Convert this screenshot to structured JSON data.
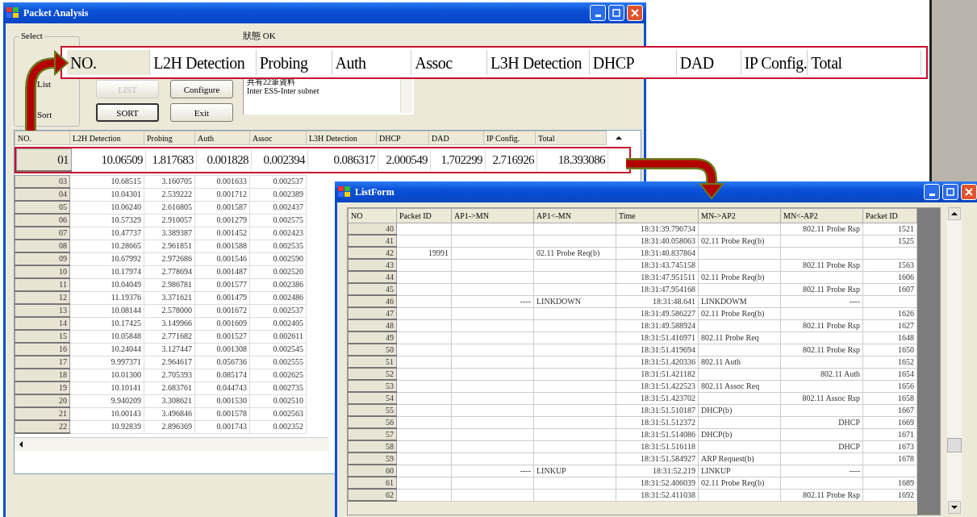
{
  "main_window": {
    "title": "Packet Analysis",
    "status": "狀態 OK",
    "select_group": {
      "label": "Select",
      "options": [
        "List",
        "Sort"
      ]
    },
    "buttons": [
      {
        "label": "LIST",
        "disabled": true
      },
      {
        "label": "Configure",
        "disabled": false
      },
      {
        "label": "SORT",
        "disabled": false
      },
      {
        "label": "Exit",
        "disabled": false
      }
    ],
    "info_lines": [
      "共有22筆資料",
      "Inter ESS-Inter subnet"
    ],
    "grid": {
      "columns": [
        "NO.",
        "L2H Detection",
        "Probing",
        "Auth",
        "Assoc",
        "L3H Detection",
        "DHCP",
        "DAD",
        "IP Config.",
        "Total"
      ],
      "rows": [
        {
          "no": "01",
          "highlighted": true,
          "values": [
            "10.06509",
            "1.817683",
            "0.001828",
            "0.002394",
            "0.086317",
            "2.000549",
            "1.702299",
            "2.716926",
            "18.393086"
          ]
        },
        {
          "no": "03",
          "highlighted": false,
          "values": [
            "10.68515",
            "3.160705",
            "0.001633",
            "0.002537"
          ]
        },
        {
          "no": "04",
          "highlighted": false,
          "values": [
            "10.04301",
            "2.539222",
            "0.001712",
            "0.002389"
          ]
        },
        {
          "no": "05",
          "highlighted": false,
          "values": [
            "10.06240",
            "2.616805",
            "0.001587",
            "0.002437"
          ]
        },
        {
          "no": "06",
          "highlighted": false,
          "values": [
            "10.57329",
            "2.910057",
            "0.001279",
            "0.002575"
          ]
        },
        {
          "no": "07",
          "highlighted": false,
          "values": [
            "10.47737",
            "3.389387",
            "0.001452",
            "0.002423"
          ]
        },
        {
          "no": "08",
          "highlighted": false,
          "values": [
            "10.28665",
            "2.961851",
            "0.001588",
            "0.002535"
          ]
        },
        {
          "no": "09",
          "highlighted": false,
          "values": [
            "10.67992",
            "2.972686",
            "0.001546",
            "0.002590"
          ]
        },
        {
          "no": "10",
          "highlighted": false,
          "values": [
            "10.17974",
            "2.778694",
            "0.001487",
            "0.002520"
          ]
        },
        {
          "no": "11",
          "highlighted": false,
          "values": [
            "10.04049",
            "2.986781",
            "0.001577",
            "0.002386"
          ]
        },
        {
          "no": "12",
          "highlighted": false,
          "values": [
            "11.19376",
            "3.371621",
            "0.001479",
            "0.002486"
          ]
        },
        {
          "no": "13",
          "highlighted": false,
          "values": [
            "10.08144",
            "2.578000",
            "0.001672",
            "0.002537"
          ]
        },
        {
          "no": "14",
          "highlighted": false,
          "values": [
            "10.17425",
            "3.149966",
            "0.001609",
            "0.002405"
          ]
        },
        {
          "no": "15",
          "highlighted": false,
          "values": [
            "10.05848",
            "2.771682",
            "0.001527",
            "0.002611"
          ]
        },
        {
          "no": "16",
          "highlighted": false,
          "values": [
            "10.24044",
            "3.127447",
            "0.001308",
            "0.002545"
          ]
        },
        {
          "no": "17",
          "highlighted": false,
          "values": [
            "9.997371",
            "2.964617",
            "0.056736",
            "0.002555"
          ]
        },
        {
          "no": "18",
          "highlighted": false,
          "values": [
            "10.01300",
            "2.705393",
            "0.085174",
            "0.002625"
          ]
        },
        {
          "no": "19",
          "highlighted": false,
          "values": [
            "10.10141",
            "2.683761",
            "0.044743",
            "0.002735"
          ]
        },
        {
          "no": "20",
          "highlighted": false,
          "values": [
            "9.940209",
            "3.308621",
            "0.001530",
            "0.002510"
          ]
        },
        {
          "no": "21",
          "highlighted": false,
          "values": [
            "10.00143",
            "3.496846",
            "0.001578",
            "0.002563"
          ]
        },
        {
          "no": "22",
          "highlighted": false,
          "values": [
            "10.92839",
            "2.896369",
            "0.001743",
            "0.002352"
          ]
        }
      ]
    }
  },
  "callout_header": {
    "columns": [
      "NO.",
      "L2H Detection",
      "Probing",
      "Auth",
      "Assoc",
      "L3H Detection",
      "DHCP",
      "DAD",
      "IP Config.",
      "Total"
    ]
  },
  "list_window": {
    "title": "ListForm",
    "columns": [
      "NO",
      "Packet ID",
      "AP1->MN",
      "AP1<-MN",
      "Time",
      "MN->AP2",
      "MN<-AP2",
      "Packet ID"
    ],
    "rows": [
      {
        "no": "40",
        "time": "18:31:39.796734",
        "mn_from_ap2": "802.11 Probe Rsp",
        "packet_id_2": "1521"
      },
      {
        "no": "41",
        "time": "18:31:40.058063",
        "mn_to_ap2": "02.11 Probe Req(b)",
        "packet_id_2": "1525"
      },
      {
        "no": "42",
        "packet_id_1": "19991",
        "ap1_from_mn": "02.11 Probe Req(b)",
        "time": "18:31:40.837864"
      },
      {
        "no": "43",
        "time": "18:31:43.745158",
        "mn_from_ap2": "802.11 Probe Rsp",
        "packet_id_2": "1563"
      },
      {
        "no": "44",
        "time": "18:31:47.951511",
        "mn_to_ap2": "02.11 Probe Req(b)",
        "packet_id_2": "1606"
      },
      {
        "no": "45",
        "time": "18:31:47.954168",
        "mn_from_ap2": "802.11 Probe Rsp",
        "packet_id_2": "1607"
      },
      {
        "no": "46",
        "ap1_to_mn": "----",
        "ap1_from_mn": "LINKDOWN",
        "time": "18:31:48.641",
        "mn_to_ap2": "LINKDOWM",
        "mn_from_ap2": "----"
      },
      {
        "no": "47",
        "time": "18:31:49.586227",
        "mn_to_ap2": "02.11 Probe Req(b)",
        "packet_id_2": "1626"
      },
      {
        "no": "48",
        "time": "18:31:49.588924",
        "mn_from_ap2": "802.11 Probe Rsp",
        "packet_id_2": "1627"
      },
      {
        "no": "49",
        "time": "18:31:51.416971",
        "mn_to_ap2": "802.11 Probe Req",
        "packet_id_2": "1648"
      },
      {
        "no": "50",
        "time": "18:31:51.419694",
        "mn_from_ap2": "802.11 Probe Rsp",
        "packet_id_2": "1650"
      },
      {
        "no": "51",
        "time": "18:31:51.420336",
        "mn_to_ap2": "802.11 Auth",
        "packet_id_2": "1652"
      },
      {
        "no": "52",
        "time": "18:31:51.421182",
        "mn_from_ap2": "802.11 Auth",
        "packet_id_2": "1654"
      },
      {
        "no": "53",
        "time": "18:31:51.422523",
        "mn_to_ap2": "802.11 Assoc Req",
        "packet_id_2": "1656"
      },
      {
        "no": "54",
        "time": "18:31:51.423702",
        "mn_from_ap2": "802.11 Assoc Rsp",
        "packet_id_2": "1658"
      },
      {
        "no": "55",
        "time": "18:31:51.510187",
        "mn_to_ap2": "DHCP(b)",
        "packet_id_2": "1667"
      },
      {
        "no": "56",
        "time": "18:31:51.512372",
        "mn_from_ap2": "DHCP",
        "packet_id_2": "1669"
      },
      {
        "no": "57",
        "time": "18:31:51.514086",
        "mn_to_ap2": "DHCP(b)",
        "packet_id_2": "1671"
      },
      {
        "no": "58",
        "time": "18:31:51.516118",
        "mn_from_ap2": "DHCP",
        "packet_id_2": "1673"
      },
      {
        "no": "59",
        "time": "18:31:51.584927",
        "mn_to_ap2": "ARP Request(b)",
        "packet_id_2": "1678"
      },
      {
        "no": "60",
        "ap1_to_mn": "----",
        "ap1_from_mn": "LINKUP",
        "time": "18:31:52.219",
        "mn_to_ap2": "LINKUP",
        "mn_from_ap2": "----"
      },
      {
        "no": "61",
        "time": "18:31:52.406039",
        "mn_to_ap2": "02.11 Probe Req(b)",
        "packet_id_2": "1689"
      },
      {
        "no": "62",
        "time": "18:31:52.411038",
        "mn_from_ap2": "802.11 Probe Rsp",
        "packet_id_2": "1692"
      }
    ]
  }
}
